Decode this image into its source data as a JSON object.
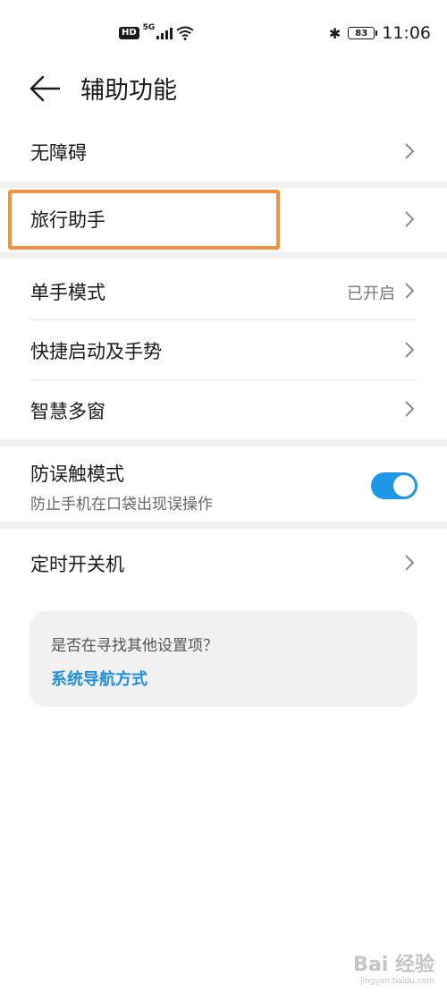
{
  "status_bar": {
    "hd": "HD",
    "network": "5G",
    "battery": "83",
    "time": "11:06"
  },
  "header": {
    "title": "辅助功能"
  },
  "items": {
    "accessibility": {
      "label": "无障碍"
    },
    "travel_assistant": {
      "label": "旅行助手"
    },
    "one_hand_mode": {
      "label": "单手模式",
      "value": "已开启"
    },
    "quick_launch": {
      "label": "快捷启动及手势"
    },
    "smart_multiwindow": {
      "label": "智慧多窗"
    },
    "accidental_touch": {
      "label": "防误触模式",
      "subtitle": "防止手机在口袋出现误操作",
      "enabled": true
    },
    "scheduled_power": {
      "label": "定时开关机"
    }
  },
  "suggestion_card": {
    "question": "是否在寻找其他设置项？",
    "link": "系统导航方式"
  },
  "watermark": {
    "line1": "Bai 经验",
    "line2": "jingyan.baidu.com"
  },
  "colors": {
    "accent": "#1e97e6",
    "highlight": "#f49141",
    "background": "#ffffff",
    "group_gap": "#f1f1f1"
  }
}
